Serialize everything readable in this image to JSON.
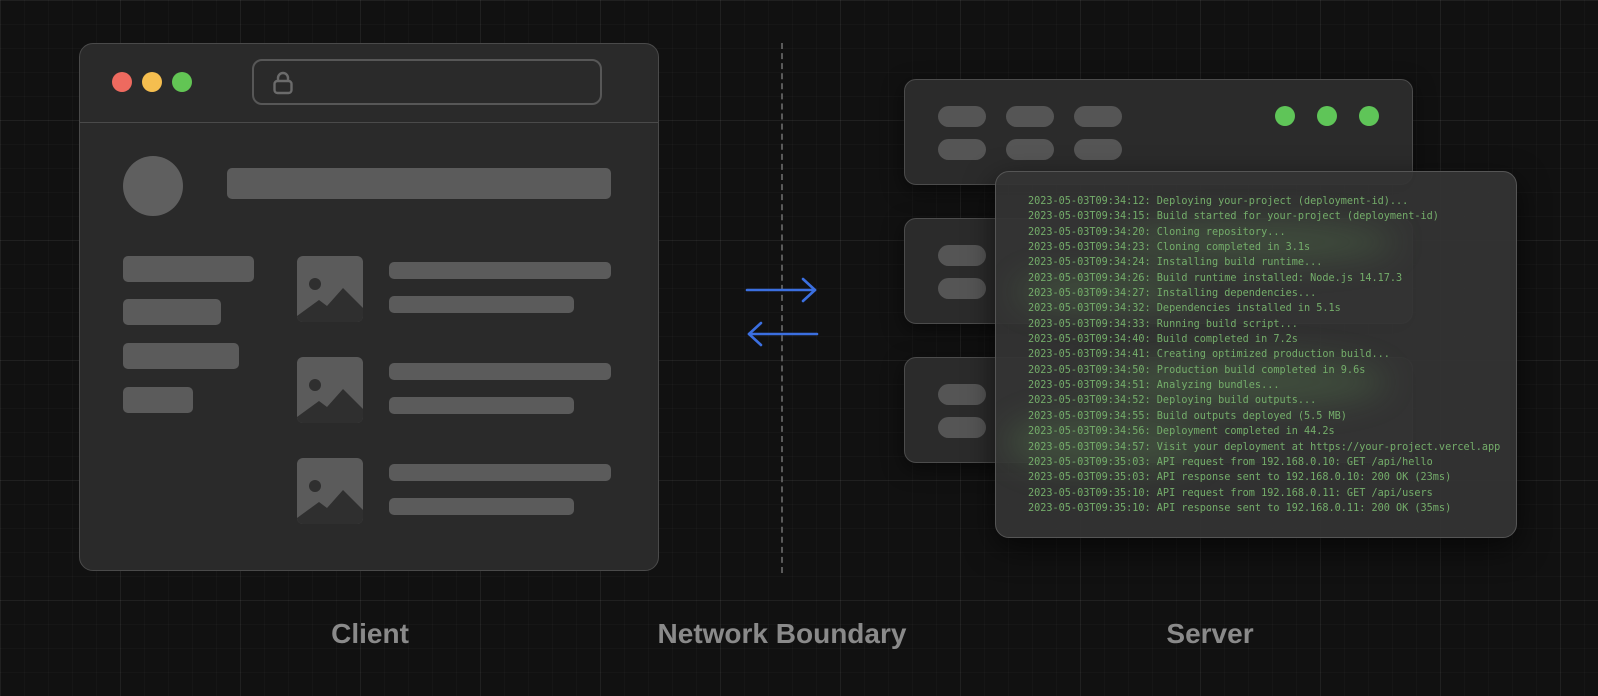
{
  "labels": {
    "client": "Client",
    "network": "Network Boundary",
    "server": "Server"
  },
  "colors": {
    "background": "#111111",
    "window_red": "#ee6a5f",
    "window_yellow": "#f5be4f",
    "window_green": "#62c554",
    "server_led": "#5fc558",
    "arrow": "#3b6fe0",
    "log_text": "#74ad6a"
  },
  "icons": {
    "lock": "lock-icon",
    "image_placeholder": "image-placeholder-icon",
    "arrow_right": "arrow-right-icon",
    "arrow_left": "arrow-left-icon"
  },
  "terminal": {
    "lines": [
      "2023-05-03T09:34:12: Deploying your-project (deployment-id)...",
      "2023-05-03T09:34:15: Build started for your-project (deployment-id)",
      "2023-05-03T09:34:20: Cloning repository...",
      "2023-05-03T09:34:23: Cloning completed in 3.1s",
      "2023-05-03T09:34:24: Installing build runtime...",
      "2023-05-03T09:34:26: Build runtime installed: Node.js 14.17.3",
      "2023-05-03T09:34:27: Installing dependencies...",
      "2023-05-03T09:34:32: Dependencies installed in 5.1s",
      "2023-05-03T09:34:33: Running build script...",
      "2023-05-03T09:34:40: Build completed in 7.2s",
      "2023-05-03T09:34:41: Creating optimized production build...",
      "2023-05-03T09:34:50: Production build completed in 9.6s",
      "2023-05-03T09:34:51: Analyzing bundles...",
      "2023-05-03T09:34:52: Deploying build outputs...",
      "2023-05-03T09:34:55: Build outputs deployed (5.5 MB)",
      "2023-05-03T09:34:56: Deployment completed in 44.2s",
      "2023-05-03T09:34:57: Visit your deployment at https://your-project.vercel.app",
      "2023-05-03T09:35:03: API request from 192.168.0.10: GET /api/hello",
      "2023-05-03T09:35:03: API response sent to 192.168.0.10: 200 OK (23ms)",
      "2023-05-03T09:35:10: API request from 192.168.0.11: GET /api/users",
      "2023-05-03T09:35:10: API response sent to 192.168.0.11: 200 OK (35ms)"
    ]
  }
}
